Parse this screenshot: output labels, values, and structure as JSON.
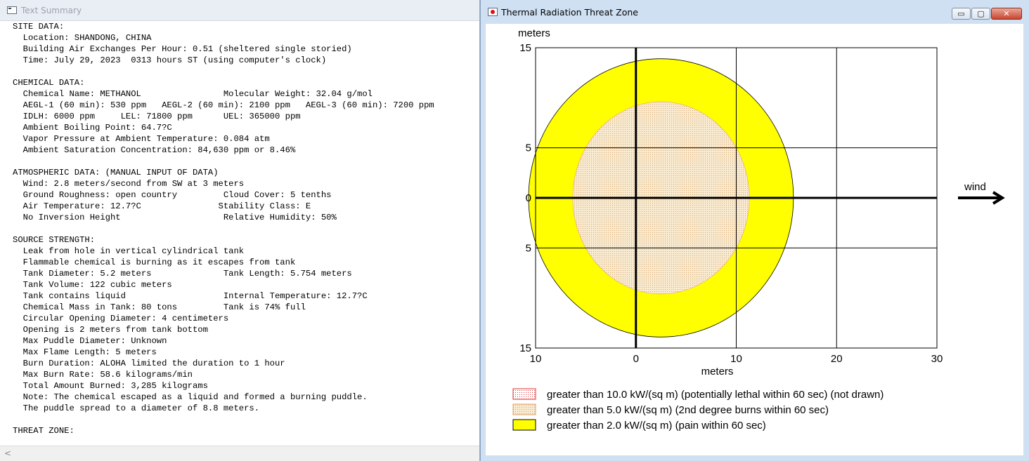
{
  "summary_window": {
    "title": "Text Summary",
    "lines": [
      "SITE DATA:",
      "  Location: SHANDONG, CHINA",
      "  Building Air Exchanges Per Hour: 0.51 (sheltered single storied)",
      "  Time: July 29, 2023  0313 hours ST (using computer's clock)",
      "",
      "CHEMICAL DATA:",
      "  Chemical Name: METHANOL                Molecular Weight: 32.04 g/mol",
      "  AEGL-1 (60 min): 530 ppm   AEGL-2 (60 min): 2100 ppm   AEGL-3 (60 min): 7200 ppm",
      "  IDLH: 6000 ppm     LEL: 71800 ppm      UEL: 365000 ppm",
      "  Ambient Boiling Point: 64.7?C",
      "  Vapor Pressure at Ambient Temperature: 0.084 atm",
      "  Ambient Saturation Concentration: 84,630 ppm or 8.46%",
      "",
      "ATMOSPHERIC DATA: (MANUAL INPUT OF DATA)",
      "  Wind: 2.8 meters/second from SW at 3 meters",
      "  Ground Roughness: open country         Cloud Cover: 5 tenths",
      "  Air Temperature: 12.7?C               Stability Class: E",
      "  No Inversion Height                    Relative Humidity: 50%",
      "",
      "SOURCE STRENGTH:",
      "  Leak from hole in vertical cylindrical tank",
      "  Flammable chemical is burning as it escapes from tank",
      "  Tank Diameter: 5.2 meters              Tank Length: 5.754 meters",
      "  Tank Volume: 122 cubic meters",
      "  Tank contains liquid                   Internal Temperature: 12.7?C",
      "  Chemical Mass in Tank: 80 tons         Tank is 74% full",
      "  Circular Opening Diameter: 4 centimeters",
      "  Opening is 2 meters from tank bottom",
      "  Max Puddle Diameter: Unknown",
      "  Max Flame Length: 5 meters",
      "  Burn Duration: ALOHA limited the duration to 1 hour",
      "  Max Burn Rate: 58.6 kilograms/min",
      "  Total Amount Burned: 3,285 kilograms",
      "  Note: The chemical escaped as a liquid and formed a burning puddle.",
      "  The puddle spread to a diameter of 8.8 meters.",
      "",
      "THREAT ZONE:"
    ],
    "scroll_left_glyph": "<"
  },
  "plot_window": {
    "title": "Thermal Radiation Threat Zone",
    "controls": {
      "minimize": "▭",
      "maximize": "▢",
      "close": "✕"
    },
    "ylabel": "meters",
    "xlabel": "meters",
    "wind_label": "wind",
    "colors": {
      "yellow_zone": "#ffff00",
      "orange_zone": "#f5e2b8",
      "red_zone": "#ff0000"
    }
  },
  "chart_data": {
    "type": "threat-zone",
    "x_ticks": [
      {
        "label": "10",
        "value": -10
      },
      {
        "label": "0",
        "value": 0
      },
      {
        "label": "10",
        "value": 10
      },
      {
        "label": "20",
        "value": 20
      },
      {
        "label": "30",
        "value": 30
      }
    ],
    "y_ticks": [
      {
        "label": "15",
        "value": 15
      },
      {
        "label": "5",
        "value": 5
      },
      {
        "label": "0",
        "value": 0
      },
      {
        "label": "5",
        "value": -5
      },
      {
        "label": "15",
        "value": -15
      }
    ],
    "xlim": [
      -10,
      30
    ],
    "ylim": [
      -15,
      15
    ],
    "zones": [
      {
        "name": "yellow",
        "cx": 2.5,
        "cy": 0,
        "rx": 13.2,
        "ry": 13.9,
        "color": "#ffff00"
      },
      {
        "name": "orange",
        "cx": 2.5,
        "cy": 0,
        "rx": 8.8,
        "ry": 9.6,
        "color": "#f5e2b8"
      }
    ],
    "legend": [
      {
        "label": "greater than 10.0 kW/(sq m) (potentially lethal within 60 sec) (not drawn)",
        "style": "red-dots"
      },
      {
        "label": "greater than 5.0 kW/(sq m) (2nd degree burns within 60 sec)",
        "style": "orange-dots"
      },
      {
        "label": "greater than 2.0 kW/(sq m) (pain within 60 sec)",
        "style": "yellow"
      }
    ]
  }
}
